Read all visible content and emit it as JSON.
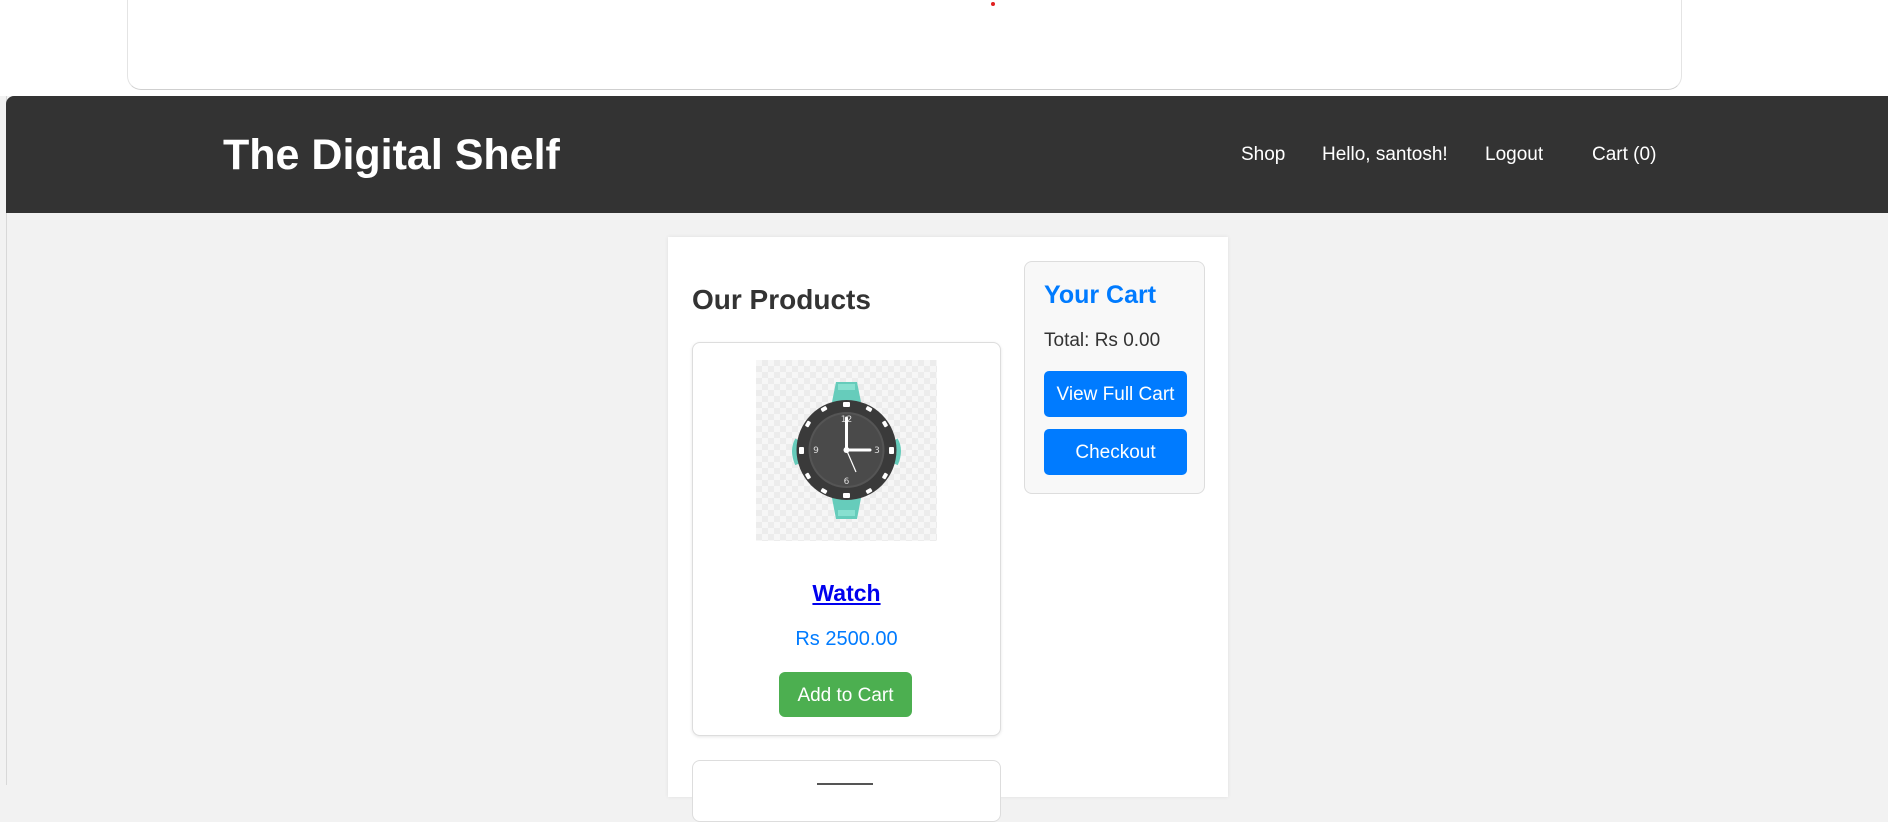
{
  "header": {
    "brand": "The Digital Shelf",
    "nav": {
      "shop": "Shop",
      "greeting": "Hello, santosh!",
      "logout": "Logout",
      "cart": "Cart (0)"
    }
  },
  "main": {
    "products_title": "Our Products",
    "products": [
      {
        "name": "Watch",
        "price": "Rs 2500.00",
        "add_label": "Add to Cart",
        "image_icon": "wristwatch-image"
      }
    ]
  },
  "cart": {
    "title": "Your Cart",
    "total": "Total: Rs 0.00",
    "view_label": "View Full Cart",
    "checkout_label": "Checkout"
  },
  "colors": {
    "header_bg": "#333333",
    "accent_blue": "#007bff",
    "add_green": "#4caf50",
    "link_blue": "#0000ee"
  }
}
